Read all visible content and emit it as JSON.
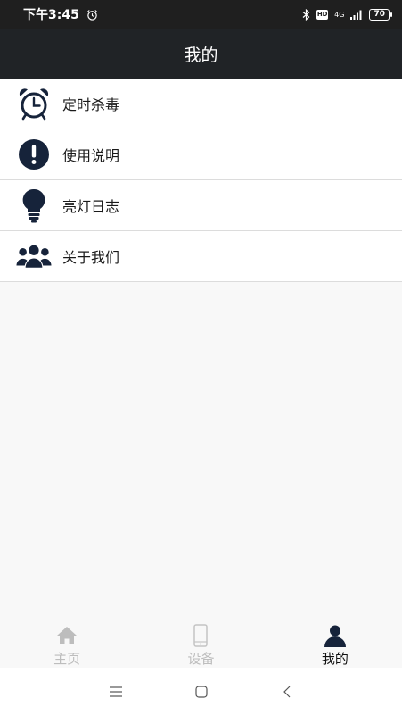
{
  "status_bar": {
    "time": "下午3:45",
    "battery": "70",
    "network": "4G"
  },
  "header": {
    "title": "我的"
  },
  "menu": {
    "items": [
      {
        "label": "定时杀毒",
        "icon": "alarm-clock-icon"
      },
      {
        "label": "使用说明",
        "icon": "exclamation-icon"
      },
      {
        "label": "亮灯日志",
        "icon": "light-bulb-icon"
      },
      {
        "label": "关于我们",
        "icon": "users-icon"
      }
    ]
  },
  "tab_bar": {
    "tabs": [
      {
        "label": "主页",
        "icon": "home-icon",
        "active": false
      },
      {
        "label": "设备",
        "icon": "phone-icon",
        "active": false
      },
      {
        "label": "我的",
        "icon": "person-icon",
        "active": true
      }
    ]
  },
  "colors": {
    "header_bg": "#202326",
    "icon_navy": "#16233a",
    "inactive_tab": "#bdbdbd",
    "active_tab": "#111111"
  }
}
